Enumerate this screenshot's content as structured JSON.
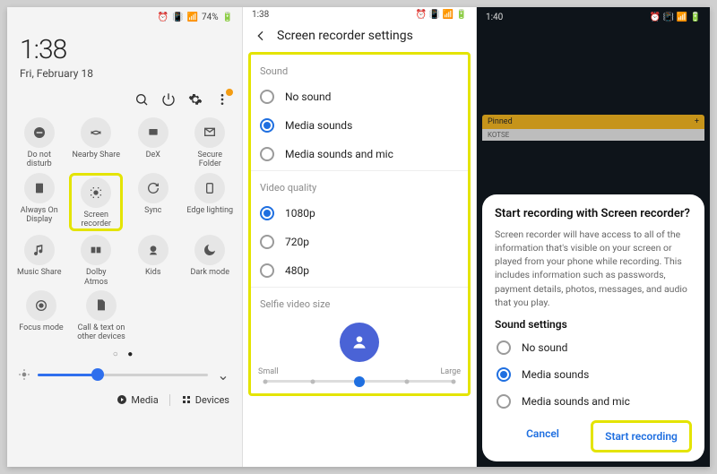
{
  "panel1": {
    "status": {
      "battery": "74%"
    },
    "clock": {
      "time": "1:38",
      "date": "Fri, February 18"
    },
    "tiles": [
      [
        {
          "name": "tile-dnd",
          "label": "Do not\ndisturb"
        },
        {
          "name": "tile-nearby",
          "label": "Nearby Share"
        },
        {
          "name": "tile-dex",
          "label": "DeX"
        },
        {
          "name": "tile-secure",
          "label": "Secure\nFolder"
        }
      ],
      [
        {
          "name": "tile-aod",
          "label": "Always On\nDisplay"
        },
        {
          "name": "tile-screenrec",
          "label": "Screen\nrecorder",
          "highlight": true
        },
        {
          "name": "tile-sync",
          "label": "Sync"
        },
        {
          "name": "tile-edge",
          "label": "Edge lighting"
        }
      ],
      [
        {
          "name": "tile-music",
          "label": "Music Share"
        },
        {
          "name": "tile-dolby",
          "label": "Dolby\nAtmos"
        },
        {
          "name": "tile-kids",
          "label": "Kids"
        },
        {
          "name": "tile-dark",
          "label": "Dark mode"
        }
      ],
      [
        {
          "name": "tile-focus",
          "label": "Focus mode"
        },
        {
          "name": "tile-calltext",
          "label": "Call & text on\nother devices"
        },
        null,
        null
      ]
    ],
    "bottom": {
      "media": "Media",
      "devices": "Devices"
    }
  },
  "panel2": {
    "clock": "1:38",
    "title": "Screen recorder settings",
    "sound": {
      "label": "Sound",
      "options": [
        {
          "label": "No sound",
          "checked": false
        },
        {
          "label": "Media sounds",
          "checked": true
        },
        {
          "label": "Media sounds and mic",
          "checked": false
        }
      ]
    },
    "quality": {
      "label": "Video quality",
      "options": [
        {
          "label": "1080p",
          "checked": true
        },
        {
          "label": "720p",
          "checked": false
        },
        {
          "label": "480p",
          "checked": false
        }
      ]
    },
    "selfie": {
      "label": "Selfie video size",
      "min": "Small",
      "max": "Large"
    }
  },
  "panel3": {
    "clock": "1:40",
    "pinned": {
      "header": "Pinned",
      "item": "KOTSE"
    },
    "dialog": {
      "title": "Start recording with Screen recorder?",
      "body": "Screen recorder will have access to all of the information that's visible on your screen or played from your phone while recording. This includes information such as passwords, payment details, photos, messages, and audio that you play.",
      "sound_heading": "Sound settings",
      "options": [
        {
          "label": "No sound",
          "checked": false
        },
        {
          "label": "Media sounds",
          "checked": true
        },
        {
          "label": "Media sounds and mic",
          "checked": false
        }
      ],
      "cancel": "Cancel",
      "start": "Start recording"
    }
  }
}
